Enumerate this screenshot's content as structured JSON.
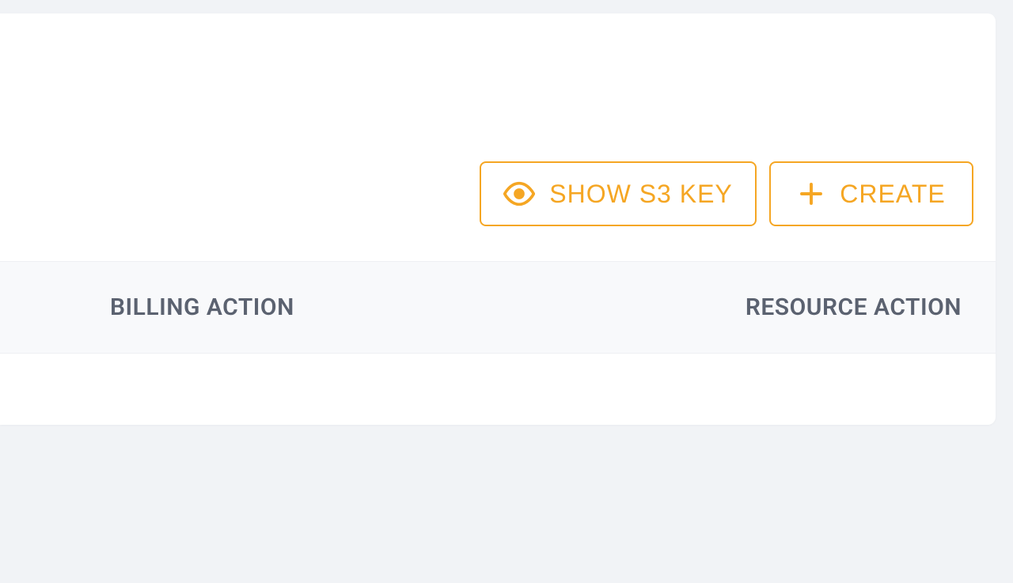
{
  "toolbar": {
    "show_key_label": "SHOW S3 KEY",
    "create_label": "CREATE"
  },
  "table": {
    "columns": {
      "billing_action": "BILLING ACTION",
      "resource_action": "RESOURCE ACTION"
    }
  },
  "colors": {
    "accent": "#f5a623"
  }
}
